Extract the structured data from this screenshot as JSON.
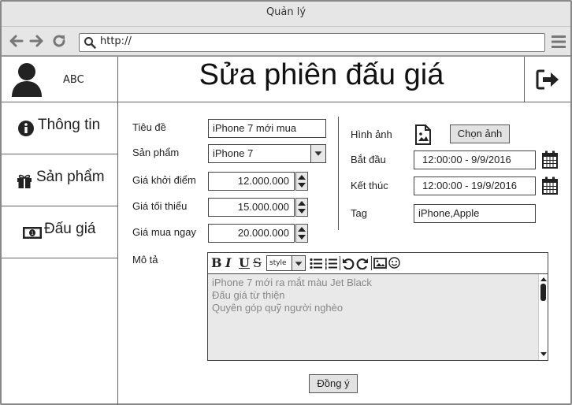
{
  "window": {
    "title": "Quản lý"
  },
  "browser": {
    "url": "http://"
  },
  "user": {
    "name": "ABC"
  },
  "header": {
    "title": "Sửa phiên đấu giá"
  },
  "sidebar": {
    "items": [
      {
        "label": "Thông tin",
        "icon": "info-icon"
      },
      {
        "label": "Sản phẩm",
        "icon": "gift-icon"
      },
      {
        "label": "Đấu giá",
        "icon": "money-icon"
      }
    ]
  },
  "form": {
    "title_label": "Tiêu đề",
    "title_value": "iPhone 7 mới mua",
    "product_label": "Sản phẩm",
    "product_value": "iPhone 7",
    "start_price_label": "Giá khởi điểm",
    "start_price_value": "12.000.000",
    "min_price_label": "Giá tối thiểu",
    "min_price_value": "15.000.000",
    "buy_now_label": "Giá mua ngay",
    "buy_now_value": "20.000.000",
    "image_label": "Hình ảnh",
    "choose_image_button": "Chọn ảnh",
    "start_label": "Bắt đầu",
    "start_value": "12:00:00 -  9/9/2016",
    "end_label": "Kết thúc",
    "end_value": "12:00:00 -  19/9/2016",
    "tag_label": "Tag",
    "tag_value": "iPhone,Apple",
    "description_label": "Mô tả",
    "editor_style_select": "style",
    "description_lines": [
      "iPhone 7 mới ra mắt màu Jet Black",
      "Đấu giá từ thiện",
      "Quyên góp quỹ người nghèo"
    ],
    "submit_button": "Đồng ý"
  }
}
